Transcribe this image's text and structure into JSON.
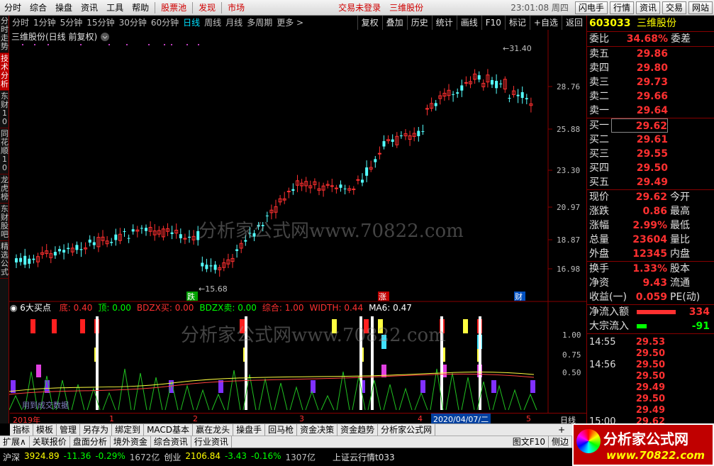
{
  "menu": {
    "items": [
      "分时",
      "综合",
      "操盘",
      "资讯",
      "工具",
      "帮助"
    ],
    "hot": [
      "股票池",
      "发现",
      "市场"
    ],
    "center": "交易未登录",
    "center2": "三维股份",
    "clock": "23:01:08 周四",
    "buttons": [
      "闪电手",
      "行情",
      "资讯",
      "交易",
      "网站"
    ]
  },
  "period": {
    "items": [
      "分时",
      "1分钟",
      "5分钟",
      "15分钟",
      "30分钟",
      "60分钟",
      "日线",
      "周线",
      "月线",
      "多周期",
      "更多 >"
    ],
    "active": "日线",
    "tools": [
      "复权",
      "叠加",
      "历史",
      "统计",
      "画线",
      "F10",
      "标记",
      "+自选",
      "返回"
    ]
  },
  "left_tabs": [
    "分时走势",
    "技术分析",
    "东财10",
    "同花顺10",
    "龙虎榜",
    "东财股吧",
    "精选公式"
  ],
  "chart": {
    "title": "三维股份(日线 前复权)",
    "hi_label": "31.40",
    "lo_label": "15.68",
    "price_ticks": [
      "28.76",
      "25.88",
      "23.30",
      "20.97",
      "18.87",
      "16.98"
    ],
    "badges": [
      "跌",
      "涨",
      "财"
    ]
  },
  "sub": {
    "name": "6大买点",
    "items": [
      {
        "k": "底",
        "v": "0.40",
        "c": "#ff3030"
      },
      {
        "k": "顶",
        "v": "0.00",
        "c": "#00ff00"
      },
      {
        "k": "BDZX买",
        "v": "0.00",
        "c": "#ff3030"
      },
      {
        "k": "BDZX卖",
        "v": "0.00",
        "c": "#00ff00"
      },
      {
        "k": "综合",
        "v": "1.00",
        "c": "#ff3030"
      },
      {
        "k": "WIDTH",
        "v": "0.44",
        "c": "#ff3030"
      },
      {
        "k": "MA6",
        "v": "0.47",
        "c": "#ffffff"
      }
    ],
    "ticks": [
      "1.00",
      "0.75",
      "0.50"
    ],
    "watermark_small": "用到成交数据"
  },
  "time_axis": {
    "labels": [
      "2019年",
      "1",
      "2",
      "3",
      "4",
      "5"
    ],
    "cursor": "2020/04/07/二",
    "right": "日线"
  },
  "quote": {
    "code": "603033",
    "name": "三维股份",
    "weibi": "34.68%",
    "weicha": "委差",
    "sells": [
      {
        "k": "卖五",
        "v": "29.86"
      },
      {
        "k": "卖四",
        "v": "29.80"
      },
      {
        "k": "卖三",
        "v": "29.73"
      },
      {
        "k": "卖二",
        "v": "29.66"
      },
      {
        "k": "卖一",
        "v": "29.64"
      }
    ],
    "buys": [
      {
        "k": "买一",
        "v": "29.62"
      },
      {
        "k": "买二",
        "v": "29.61"
      },
      {
        "k": "买三",
        "v": "29.55"
      },
      {
        "k": "买四",
        "v": "29.50"
      },
      {
        "k": "买五",
        "v": "29.49"
      }
    ],
    "stats": [
      {
        "k": "现价",
        "v": "29.62",
        "k2": "今开"
      },
      {
        "k": "涨跌",
        "v": "0.86",
        "k2": "最高"
      },
      {
        "k": "涨幅",
        "v": "2.99%",
        "k2": "最低"
      },
      {
        "k": "总量",
        "v": "23604",
        "k2": "量比"
      },
      {
        "k": "外盘",
        "v": "12345",
        "k2": "内盘"
      }
    ],
    "stats2": [
      {
        "k": "换手",
        "v": "1.33%",
        "k2": "股本"
      },
      {
        "k": "净资",
        "v": "9.43",
        "k2": "流通"
      },
      {
        "k": "收益(一)",
        "v": "0.059",
        "k2": "PE(动)"
      }
    ],
    "flow": [
      {
        "k": "净流入额",
        "v": "334",
        "c": "#ff3030"
      },
      {
        "k": "大宗流入",
        "v": "-91",
        "c": "#00ff00"
      }
    ],
    "ticks": [
      {
        "t": "14:55",
        "p": "29.53"
      },
      {
        "t": "",
        "p": "29.50"
      },
      {
        "t": "14:56",
        "p": "29.50"
      },
      {
        "t": "",
        "p": "29.50"
      },
      {
        "t": "",
        "p": "29.49"
      },
      {
        "t": "",
        "p": "29.50"
      },
      {
        "t": "",
        "p": "29.49"
      },
      {
        "t": "15:00",
        "p": "29.62"
      }
    ]
  },
  "tabs1": [
    "指标",
    "模板",
    "管理",
    "另存为",
    "绑定到",
    "MACD基本",
    "赢在龙头",
    "操盘手",
    "回马枪",
    "资金决策",
    "资金趋势",
    "分析家公式网"
  ],
  "tabs2": [
    "扩展∧",
    "关联报价",
    "盘面分析",
    "境外资金",
    "综合资讯",
    "行业资讯"
  ],
  "tabs2_right": [
    "图文F10",
    "侧边"
  ],
  "status": {
    "items": [
      {
        "k": "沪深",
        "v": "3924.89",
        "c": "#ffff00"
      },
      {
        "k": "",
        "v": "-11.36",
        "c": "#00ff00"
      },
      {
        "k": "",
        "v": "-0.29%",
        "c": "#00ff00"
      },
      {
        "k": "",
        "v": "1672亿",
        "c": "#c0c0c0"
      },
      {
        "k": "创业",
        "v": "2106.84",
        "c": "#ffff00"
      },
      {
        "k": "",
        "v": "-3.43",
        "c": "#00ff00"
      },
      {
        "k": "",
        "v": "-0.16%",
        "c": "#00ff00"
      },
      {
        "k": "",
        "v": "1307亿",
        "c": "#c0c0c0"
      }
    ],
    "msg": "上证云行情t033"
  },
  "watermark": "分析家公式网www.70822.com",
  "logo": {
    "title": "分析家公式网",
    "url": "www.70822.com"
  }
}
